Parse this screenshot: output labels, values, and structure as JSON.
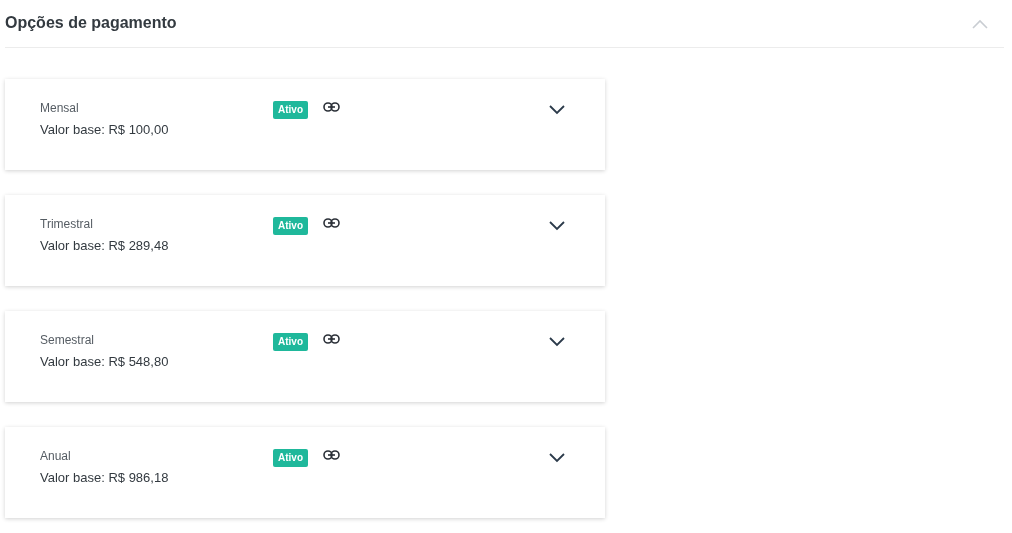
{
  "section": {
    "title": "Opções de pagamento",
    "expanded": true
  },
  "plans": [
    {
      "name": "Mensal",
      "price": "Valor base: R$ 100,00",
      "status": "Ativo",
      "expanded": false
    },
    {
      "name": "Trimestral",
      "price": "Valor base: R$ 289,48",
      "status": "Ativo",
      "expanded": false
    },
    {
      "name": "Semestral",
      "price": "Valor base: R$ 548,80",
      "status": "Ativo",
      "expanded": false
    },
    {
      "name": "Anual",
      "price": "Valor base: R$ 986,18",
      "status": "Ativo",
      "expanded": false
    }
  ]
}
